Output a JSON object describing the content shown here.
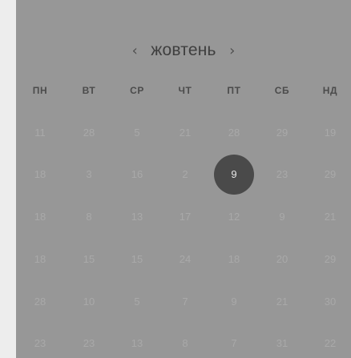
{
  "calendar": {
    "month_label": "жовтень",
    "prev_icon": "chevron-left-icon",
    "next_icon": "chevron-right-icon",
    "prev_glyph": "‹",
    "next_glyph": "›",
    "weekdays": [
      "ПН",
      "ВТ",
      "СР",
      "ЧТ",
      "ПТ",
      "СБ",
      "НД"
    ],
    "weeks": [
      [
        "11",
        "28",
        "5",
        "21",
        "28",
        "29",
        "19"
      ],
      [
        "18",
        "3",
        "16",
        "2",
        "9",
        "23",
        "29"
      ],
      [
        "18",
        "8",
        "13",
        "17",
        "12",
        "9",
        "21"
      ],
      [
        "18",
        "15",
        "15",
        "24",
        "18",
        "20",
        "29"
      ],
      [
        "28",
        "10",
        "5",
        "7",
        "9",
        "21",
        "30"
      ],
      [
        "23",
        "23",
        "13",
        "8",
        "7",
        "31",
        "22"
      ]
    ],
    "selected": {
      "week": 1,
      "day": 4
    },
    "colors": {
      "panel": "#979797",
      "selected_fill": "#4a4a4a",
      "day_text": "#a9a9a9"
    }
  }
}
